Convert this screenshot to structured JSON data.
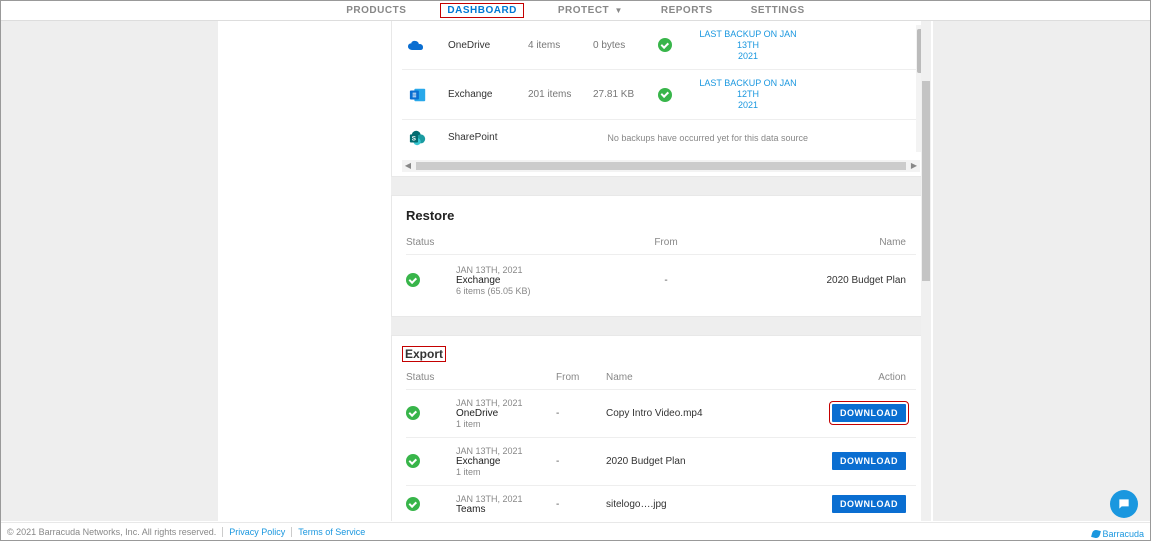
{
  "nav": {
    "products": "PRODUCTS",
    "dashboard": "DASHBOARD",
    "protect": "PROTECT",
    "reports": "REPORTS",
    "settings": "SETTINGS"
  },
  "backup": {
    "rows": [
      {
        "service": "OneDrive",
        "items": "4 items",
        "size": "0 bytes",
        "lastbackup_line1": "LAST BACKUP ON JAN 13TH",
        "lastbackup_line2": "2021"
      },
      {
        "service": "Exchange",
        "items": "201 items",
        "size": "27.81 KB",
        "lastbackup_line1": "LAST BACKUP ON JAN 12TH",
        "lastbackup_line2": "2021"
      },
      {
        "service": "SharePoint",
        "note": "No backups have occurred yet for this data source"
      }
    ]
  },
  "restore": {
    "title": "Restore",
    "headers": {
      "status": "Status",
      "from": "From",
      "name": "Name"
    },
    "rows": [
      {
        "date": "JAN 13TH, 2021",
        "service": "Exchange",
        "detail": "6 items  (65.05 KB)",
        "from": "-",
        "name": "2020 Budget Plan"
      }
    ]
  },
  "export": {
    "title": "Export",
    "headers": {
      "status": "Status",
      "from": "From",
      "name": "Name",
      "action": "Action"
    },
    "rows": [
      {
        "date": "JAN 13TH, 2021",
        "service": "OneDrive",
        "detail": "1 item",
        "from": "-",
        "name": "Copy Intro Video.mp4",
        "action": "DOWNLOAD"
      },
      {
        "date": "JAN 13TH, 2021",
        "service": "Exchange",
        "detail": "1 item",
        "from": "-",
        "name": "2020 Budget Plan",
        "action": "DOWNLOAD"
      },
      {
        "date": "JAN 13TH, 2021",
        "service": "Teams",
        "detail": "",
        "from": "-",
        "name": "sitelogo….jpg",
        "action": "DOWNLOAD"
      }
    ]
  },
  "footer": {
    "copyright": "© 2021 Barracuda Networks, Inc. All rights reserved.",
    "privacy": "Privacy Policy",
    "terms": "Terms of Service",
    "brand": "Barracuda"
  }
}
